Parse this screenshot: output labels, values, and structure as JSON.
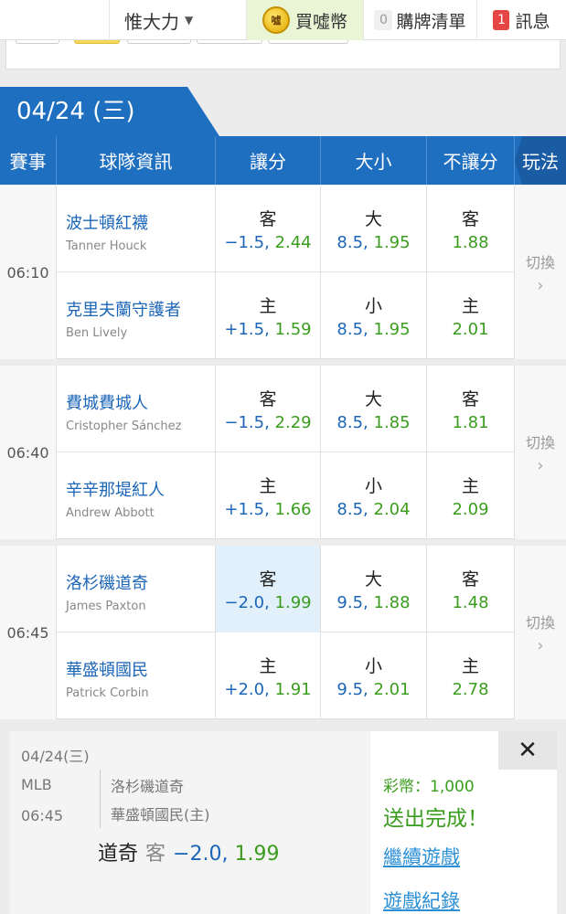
{
  "nav": {
    "user": "惟大力",
    "coins_label": "買噓幣",
    "coin_icon_text": "噓",
    "cart_count": "0",
    "cart_label": "購牌清單",
    "msg_count": "1",
    "msg_label": "訊息"
  },
  "date_header": "04/24 (三)",
  "table_header": {
    "time": "賽事",
    "team": "球隊資訊",
    "spread": "讓分",
    "total": "大小",
    "moneyline": "不讓分",
    "play": "玩法"
  },
  "matches": [
    {
      "time": "06:10",
      "switch": "切換",
      "rows": [
        {
          "team": "波士頓紅襪",
          "pitcher": "Tanner Houck",
          "spread_label": "客",
          "spread_line": "−1.5,",
          "spread_price": "2.44",
          "total_label": "大",
          "total_line": "8.5,",
          "total_price": "1.95",
          "ml_label": "客",
          "ml_price": "1.88"
        },
        {
          "team": "克里夫蘭守護者",
          "pitcher": "Ben Lively",
          "spread_label": "主",
          "spread_line": "+1.5,",
          "spread_price": "1.59",
          "total_label": "小",
          "total_line": "8.5,",
          "total_price": "1.95",
          "ml_label": "主",
          "ml_price": "2.01"
        }
      ]
    },
    {
      "time": "06:40",
      "switch": "切換",
      "rows": [
        {
          "team": "費城費城人",
          "pitcher": "Cristopher Sánchez",
          "spread_label": "客",
          "spread_line": "−1.5,",
          "spread_price": "2.29",
          "total_label": "大",
          "total_line": "8.5,",
          "total_price": "1.85",
          "ml_label": "客",
          "ml_price": "1.81"
        },
        {
          "team": "辛辛那堤紅人",
          "pitcher": "Andrew Abbott",
          "spread_label": "主",
          "spread_line": "+1.5,",
          "spread_price": "1.66",
          "total_label": "小",
          "total_line": "8.5,",
          "total_price": "2.04",
          "ml_label": "主",
          "ml_price": "2.09"
        }
      ]
    },
    {
      "time": "06:45",
      "switch": "切換",
      "rows": [
        {
          "team": "洛杉磯道奇",
          "pitcher": "James Paxton",
          "spread_label": "客",
          "spread_line": "−2.0,",
          "spread_price": "1.99",
          "total_label": "大",
          "total_line": "9.5,",
          "total_price": "1.88",
          "ml_label": "客",
          "ml_price": "1.48"
        },
        {
          "team": "華盛頓國民",
          "pitcher": "Patrick Corbin",
          "spread_label": "主",
          "spread_line": "+2.0,",
          "spread_price": "1.91",
          "total_label": "小",
          "total_line": "9.5,",
          "total_price": "2.01",
          "ml_label": "主",
          "ml_price": "2.78"
        }
      ]
    }
  ],
  "panel": {
    "date": "04/24(三)",
    "league": "MLB",
    "time": "06:45",
    "team1": "洛杉磯道奇",
    "team2": "華盛頓國民(主)",
    "bet_team": "道奇",
    "bet_side": "客",
    "bet_line": "−2.0,",
    "bet_price": "1.99",
    "coins": "彩幣：1,000",
    "status": "送出完成！",
    "continue": "繼續遊戲",
    "history": "遊戲紀錄",
    "close": "✕"
  },
  "colors": {
    "primary": "#1f6fc1",
    "line_blue": "#1c66b8",
    "price_green": "#3a9d1e",
    "selected_bg": "#e1f0fb"
  }
}
